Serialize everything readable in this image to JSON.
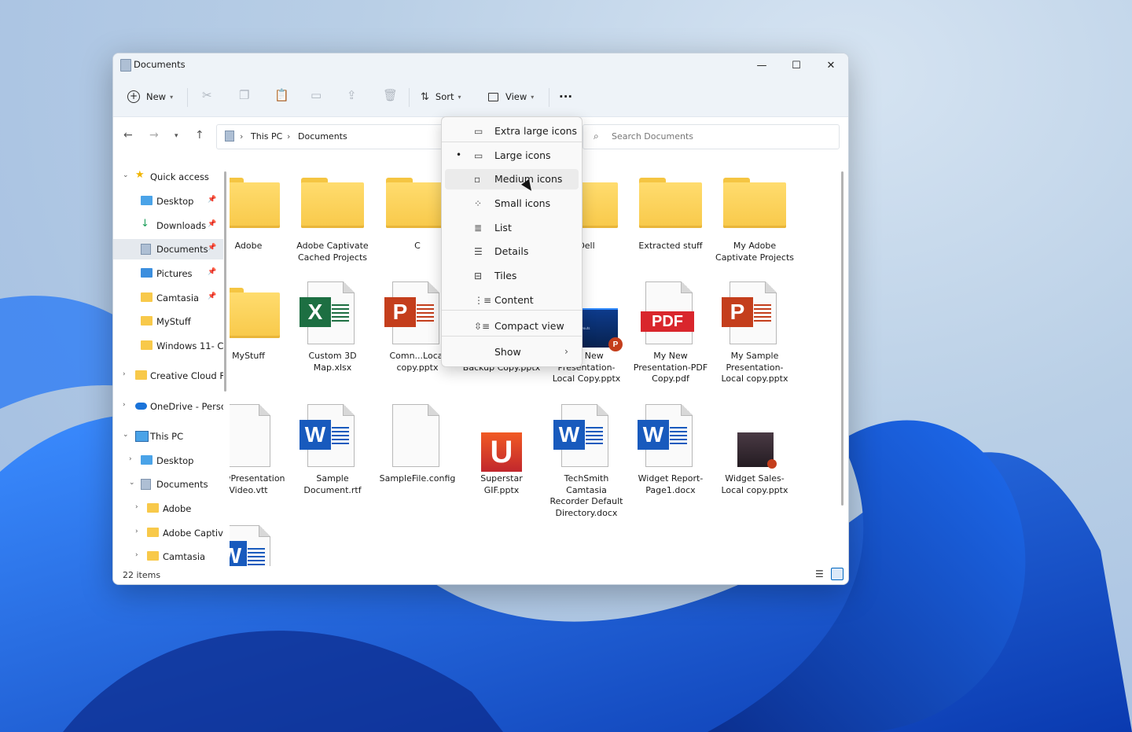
{
  "window": {
    "title": "Documents"
  },
  "window_controls": {
    "minimize": "—",
    "maximize": "☐",
    "close": "✕"
  },
  "toolbar": {
    "new_label": "New",
    "sort_label": "Sort",
    "view_label": "View",
    "more_label": "···"
  },
  "address": {
    "segments": [
      "This PC",
      "Documents"
    ]
  },
  "search": {
    "placeholder": "Search Documents"
  },
  "nav": [
    {
      "label": "Quick access",
      "icon": "star-icon"
    },
    {
      "label": "Desktop",
      "icon": "desktop-icon",
      "pinned": true
    },
    {
      "label": "Downloads",
      "icon": "download-icon",
      "pinned": true
    },
    {
      "label": "Documents",
      "icon": "documents-icon",
      "pinned": true,
      "selected": true
    },
    {
      "label": "Pictures",
      "icon": "pictures-icon",
      "pinned": true
    },
    {
      "label": "Camtasia",
      "icon": "folder-icon",
      "pinned": true
    },
    {
      "label": "MyStuff",
      "icon": "folder-icon"
    },
    {
      "label": "Windows 11- C",
      "icon": "folder-icon"
    },
    {
      "label": "Creative Cloud F",
      "icon": "creative-cloud-icon"
    },
    {
      "label": "OneDrive - Perso",
      "icon": "onedrive-icon"
    },
    {
      "label": "This PC",
      "icon": "pc-icon"
    },
    {
      "label": "Desktop",
      "icon": "desktop-icon"
    },
    {
      "label": "Documents",
      "icon": "documents-icon"
    },
    {
      "label": "Adobe",
      "icon": "folder-icon"
    },
    {
      "label": "Adobe Captiv",
      "icon": "folder-icon"
    },
    {
      "label": "Camtasia",
      "icon": "folder-icon"
    }
  ],
  "files": [
    {
      "name": "Adobe",
      "type": "folder"
    },
    {
      "name": "Adobe Captivate Cached Projects",
      "type": "folder"
    },
    {
      "name": "C",
      "type": "folder"
    },
    {
      "name": "Dell",
      "type": "folder"
    },
    {
      "name": "Extracted stuff",
      "type": "folder"
    },
    {
      "name": "My Adobe Captivate Projects",
      "type": "folder"
    },
    {
      "name": "MyStuff",
      "type": "folder"
    },
    {
      "name": "Custom 3D Map.xlsx",
      "type": "excel",
      "badge": "X"
    },
    {
      "name": "Comn...Local copy.pptx",
      "type": "powerpoint",
      "badge": "P"
    },
    {
      "name": "...Presentation Backup Copy.pptx",
      "type": "powerpoint"
    },
    {
      "name": "My New Presentation-Local Copy.pptx",
      "type": "pptx-thumb",
      "thumb_text": "PowerPoint Layouts",
      "badge": "P"
    },
    {
      "name": "My New Presentation-PDF Copy.pdf",
      "type": "pdf",
      "badge": "PDF"
    },
    {
      "name": "My Sample Presentation-Local copy.pptx",
      "type": "powerpoint",
      "badge": "P"
    },
    {
      "name": "NewPresentation Video.vtt",
      "type": "blank"
    },
    {
      "name": "Sample Document.rtf",
      "type": "word",
      "badge": "W"
    },
    {
      "name": "SampleFile.config",
      "type": "blank"
    },
    {
      "name": "Superstar GIF.pptx",
      "type": "gif-thumb",
      "badge": "U"
    },
    {
      "name": "TechSmith Camtasia Recorder Default Directory.docx",
      "type": "word",
      "badge": "W"
    },
    {
      "name": "Widget Report-Page1.docx",
      "type": "word",
      "badge": "W"
    },
    {
      "name": "Widget Sales-Local copy.pptx",
      "type": "pptx-dark"
    },
    {
      "name": "",
      "type": "word",
      "badge": "W"
    }
  ],
  "status": {
    "count": "22 items"
  },
  "view_menu": {
    "items": [
      {
        "label": "Extra large icons",
        "icon": "monitor-icon"
      },
      {
        "label": "Large icons",
        "icon": "monitor-icon",
        "selected": true
      },
      {
        "label": "Medium icons",
        "icon": "monitor-small-icon"
      },
      {
        "label": "Small icons",
        "icon": "grid-icon"
      },
      {
        "label": "List",
        "icon": "list-icon"
      },
      {
        "label": "Details",
        "icon": "details-icon"
      },
      {
        "label": "Tiles",
        "icon": "tiles-icon"
      },
      {
        "label": "Content",
        "icon": "content-icon"
      },
      {
        "label": "Compact view",
        "icon": "compact-icon"
      },
      {
        "label": "Show",
        "icon": ""
      }
    ],
    "hovered": "Medium icons",
    "selected_marker": "•",
    "submenu_arrow": "›"
  },
  "colors": {
    "accent": "#0067c0",
    "folder": "#f8c94a",
    "excel": "#1d6f42",
    "word": "#185abd",
    "powerpoint": "#c43e1c",
    "pdf": "#d9262c"
  }
}
